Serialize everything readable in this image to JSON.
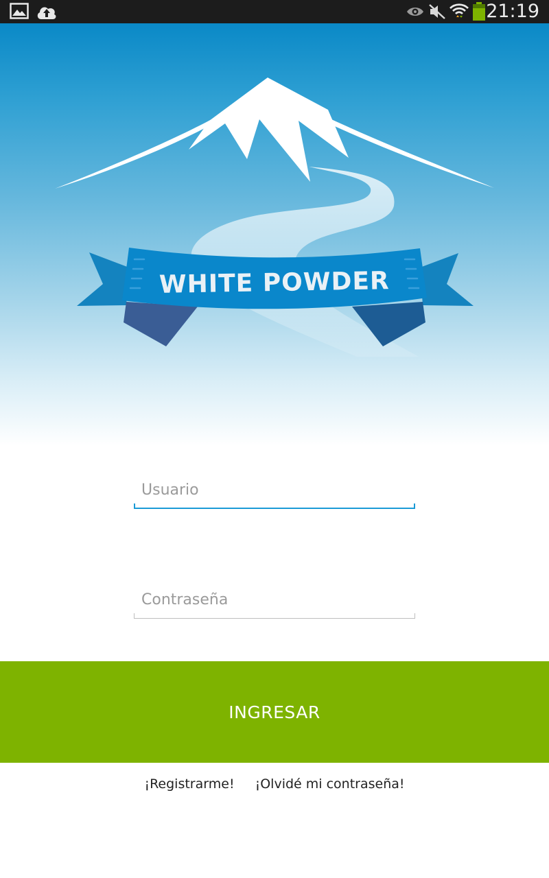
{
  "status_bar": {
    "time": "21:19",
    "left_icons": [
      "gallery-icon",
      "cloud-upload-icon"
    ],
    "right_icons": [
      "eye-icon",
      "mute-icon",
      "wifi-icon",
      "battery-icon"
    ]
  },
  "logo": {
    "title": "WHITE POWDER",
    "colors": {
      "ribbon": "#0b7fc4",
      "ribbon_dark": "#1d5c94",
      "snow": "#ffffff"
    }
  },
  "form": {
    "username_placeholder": "Usuario",
    "password_placeholder": "Contraseña",
    "focus_color": "#1a9ad6"
  },
  "login_button": {
    "label": "INGRESAR",
    "color": "#7eb300"
  },
  "links": {
    "register": "¡Registrarme!",
    "forgot_password": "¡Olvidé mi contraseña!"
  }
}
